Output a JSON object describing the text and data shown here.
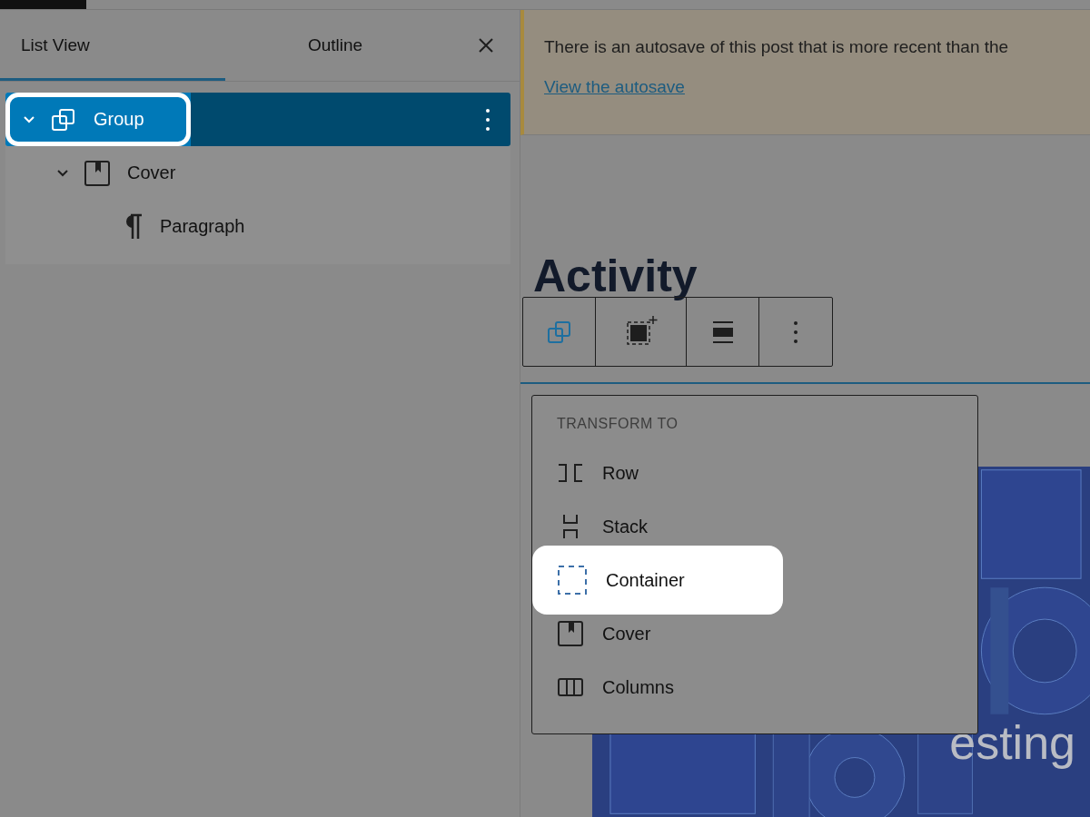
{
  "sidebar": {
    "tabs": [
      {
        "label": "List View",
        "selected": true
      },
      {
        "label": "Outline",
        "selected": false
      }
    ],
    "tree": [
      {
        "label": "Group",
        "kind": "group",
        "selected": true,
        "expanded": true,
        "children": [
          {
            "label": "Cover",
            "kind": "cover",
            "selected": false,
            "expanded": true,
            "children": [
              {
                "label": "Paragraph",
                "kind": "paragraph",
                "selected": false
              }
            ]
          }
        ]
      }
    ]
  },
  "notice": {
    "text": "There is an autosave of this post that is more recent than the",
    "link": "View the autosave"
  },
  "editor": {
    "heading": "Activity",
    "cover_text": "esting",
    "toolbar": [
      {
        "kind": "group",
        "selected": true
      },
      {
        "kind": "cover-add",
        "selected": false
      },
      {
        "kind": "align",
        "selected": false
      },
      {
        "kind": "more",
        "selected": false
      }
    ],
    "menu": {
      "title": "TRANSFORM TO",
      "items": [
        {
          "label": "Row",
          "kind": "row",
          "highlighted": false
        },
        {
          "label": "Stack",
          "kind": "stack",
          "highlighted": false
        },
        {
          "label": "Container",
          "kind": "container",
          "highlighted": true
        },
        {
          "label": "Cover",
          "kind": "cover",
          "highlighted": false
        },
        {
          "label": "Columns",
          "kind": "columns",
          "highlighted": false
        }
      ]
    }
  }
}
